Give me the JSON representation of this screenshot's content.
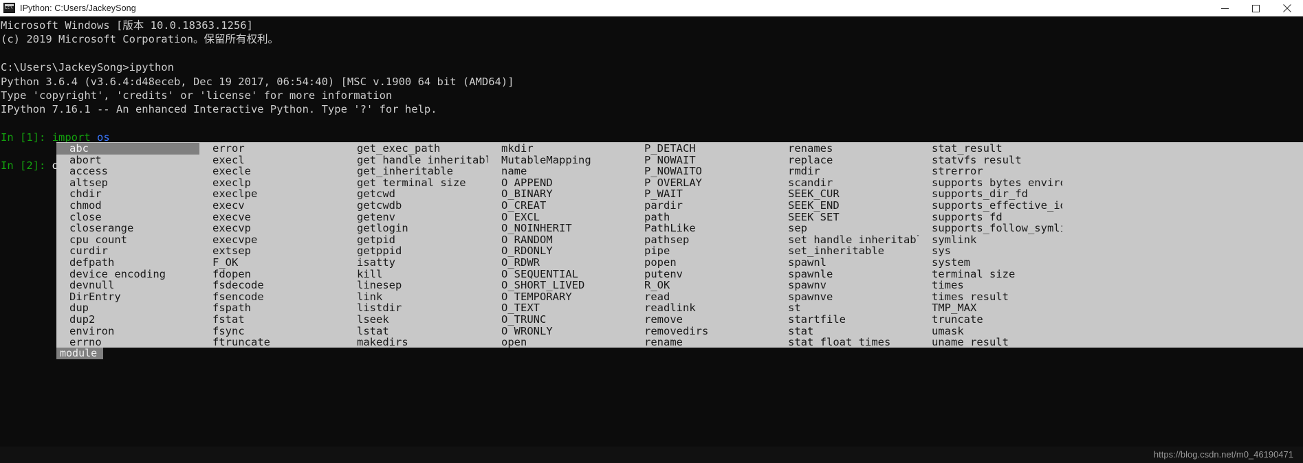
{
  "window": {
    "title": "IPython: C:Users/JackeySong",
    "icon": "console-app-icon",
    "minimize_label": "minimize-icon",
    "maximize_label": "maximize-icon",
    "close_label": "close-icon"
  },
  "theme": {
    "terminal_bg": "#0c0c0c",
    "terminal_fg": "#cccccc",
    "prompt_green": "#13a10e",
    "module_blue": "#3b78ff",
    "popup_bg": "#c8c8c8",
    "popup_selected_bg": "#808080",
    "titlebar_bg": "#ffffff"
  },
  "terminal": {
    "lines": [
      {
        "segments": [
          {
            "text": "Microsoft Windows [版本 10.0.18363.1256]",
            "color": "white"
          }
        ]
      },
      {
        "segments": [
          {
            "text": "(c) 2019 Microsoft Corporation。保留所有权利。",
            "color": "white"
          }
        ]
      },
      {
        "segments": [
          {
            "text": "",
            "color": "white"
          }
        ]
      },
      {
        "segments": [
          {
            "text": "C:\\Users\\JackeySong>ipython",
            "color": "white"
          }
        ]
      },
      {
        "segments": [
          {
            "text": "Python 3.6.4 (v3.6.4:d48eceb, Dec 19 2017, 06:54:40) [MSC v.1900 64 bit (AMD64)]",
            "color": "white"
          }
        ]
      },
      {
        "segments": [
          {
            "text": "Type 'copyright', 'credits' or 'license' for more information",
            "color": "white"
          }
        ]
      },
      {
        "segments": [
          {
            "text": "IPython 7.16.1 -- An enhanced Interactive Python. Type '?' for help.",
            "color": "white"
          }
        ]
      },
      {
        "segments": [
          {
            "text": "",
            "color": "white"
          }
        ]
      },
      {
        "segments": [
          {
            "text": "In [1]: ",
            "color": "green"
          },
          {
            "text": "import ",
            "color": "green"
          },
          {
            "text": "os",
            "color": "blue"
          }
        ]
      },
      {
        "segments": [
          {
            "text": "",
            "color": "white"
          }
        ]
      },
      {
        "segments": [
          {
            "text": "In [2]: ",
            "color": "green"
          },
          {
            "text": "os.abc",
            "color": "bright"
          },
          {
            "text": "",
            "color": "cursor"
          }
        ]
      }
    ]
  },
  "completion": {
    "selected": "abc",
    "type_label": "module",
    "columns": [
      [
        "abc",
        "abort",
        "access",
        "altsep",
        "chdir",
        "chmod",
        "close",
        "closerange",
        "cpu_count",
        "curdir",
        "defpath",
        "device_encoding",
        "devnull",
        "DirEntry",
        "dup",
        "dup2",
        "environ",
        "errno"
      ],
      [
        "error",
        "execl",
        "execle",
        "execlp",
        "execlpe",
        "execv",
        "execve",
        "execvp",
        "execvpe",
        "extsep",
        "F_OK",
        "fdopen",
        "fsdecode",
        "fsencode",
        "fspath",
        "fstat",
        "fsync",
        "ftruncate"
      ],
      [
        "get_exec_path",
        "get_handle_inheritable",
        "get_inheritable",
        "get_terminal_size",
        "getcwd",
        "getcwdb",
        "getenv",
        "getlogin",
        "getpid",
        "getppid",
        "isatty",
        "kill",
        "linesep",
        "link",
        "listdir",
        "lseek",
        "lstat",
        "makedirs"
      ],
      [
        "mkdir",
        "MutableMapping",
        "name",
        "O_APPEND",
        "O_BINARY",
        "O_CREAT",
        "O_EXCL",
        "O_NOINHERIT",
        "O_RANDOM",
        "O_RDONLY",
        "O_RDWR",
        "O_SEQUENTIAL",
        "O_SHORT_LIVED",
        "O_TEMPORARY",
        "O_TEXT",
        "O_TRUNC",
        "O_WRONLY",
        "open"
      ],
      [
        "P_DETACH",
        "P_NOWAIT",
        "P_NOWAITO",
        "P_OVERLAY",
        "P_WAIT",
        "pardir",
        "path",
        "PathLike",
        "pathsep",
        "pipe",
        "popen",
        "putenv",
        "R_OK",
        "read",
        "readlink",
        "remove",
        "removedirs",
        "rename"
      ],
      [
        "renames",
        "replace",
        "rmdir",
        "scandir",
        "SEEK_CUR",
        "SEEK_END",
        "SEEK_SET",
        "sep",
        "set_handle_inheritable",
        "set_inheritable",
        "spawnl",
        "spawnle",
        "spawnv",
        "spawnve",
        "st",
        "startfile",
        "stat",
        "stat_float_times"
      ],
      [
        "stat_result",
        "statvfs_result",
        "strerror",
        "supports_bytes_environ",
        "supports_dir_fd",
        "supports_effective_ids",
        "supports_fd",
        "supports_follow_symlinks",
        "symlink",
        "sys",
        "system",
        "terminal_size",
        "times",
        "times_result",
        "TMP_MAX",
        "truncate",
        "umask",
        "uname_result"
      ]
    ]
  },
  "footer": {
    "watermark": "https://blog.csdn.net/m0_46190471"
  }
}
